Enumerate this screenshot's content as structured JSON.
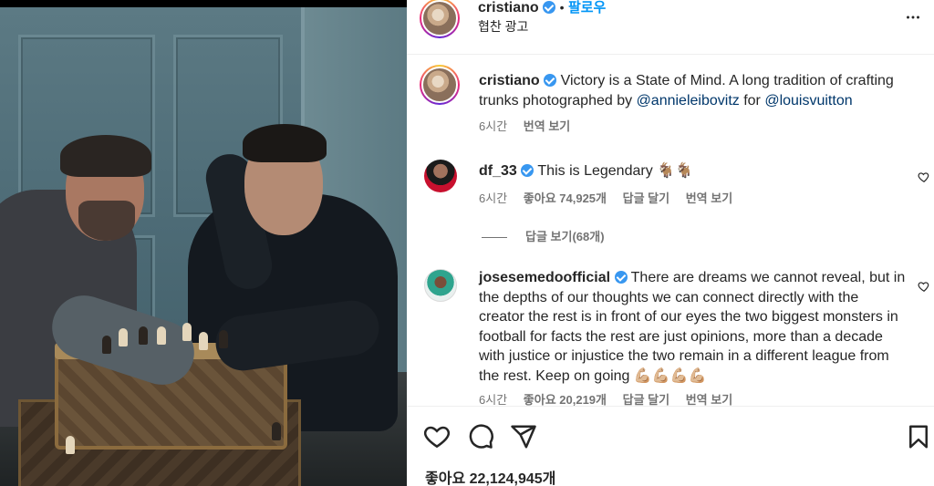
{
  "post": {
    "author": "cristiano",
    "follow_label": "팔로우",
    "separator": "•",
    "subtitle": "협찬 광고",
    "more_glyph": "⋮"
  },
  "caption": {
    "username": "cristiano",
    "text": " Victory is a State of Mind. A long tradition of crafting trunks photographed by ",
    "mention1": "@annieleibovitz",
    "middle": " for ",
    "mention2": "@louisvuitton",
    "time": "6시간",
    "translate": "번역 보기"
  },
  "comments": [
    {
      "username": "df_33",
      "text": " This is Legendary 🐐🐐",
      "time": "6시간",
      "likes": "좋아요 74,925개",
      "reply": "답글 달기",
      "translate": "번역 보기",
      "replies": "답글 보기(68개)"
    },
    {
      "username": "josesemedoofficial",
      "text": " There are dreams we cannot reveal, but in the depths of our thoughts we can connect directly with the creator the rest is in front of our eyes the two biggest monsters in football for facts the rest are just opinions, more than a decade with justice or injustice the two remain in a different league from the rest. Keep on going 💪🏼💪🏼💪🏼💪🏼",
      "time": "6시간",
      "likes": "좋아요 20,219개",
      "reply": "답글 달기",
      "translate": "번역 보기"
    }
  ],
  "footer": {
    "likes": "좋아요 22,124,945개"
  },
  "icons": [
    "more-icon",
    "heart-icon",
    "comment-icon",
    "share-icon",
    "bookmark-icon",
    "verified-badge-icon"
  ],
  "colors": {
    "link": "#0095f6",
    "mention": "#00376b",
    "verified": "#3897f0",
    "text": "#262626",
    "muted": "#737373"
  }
}
